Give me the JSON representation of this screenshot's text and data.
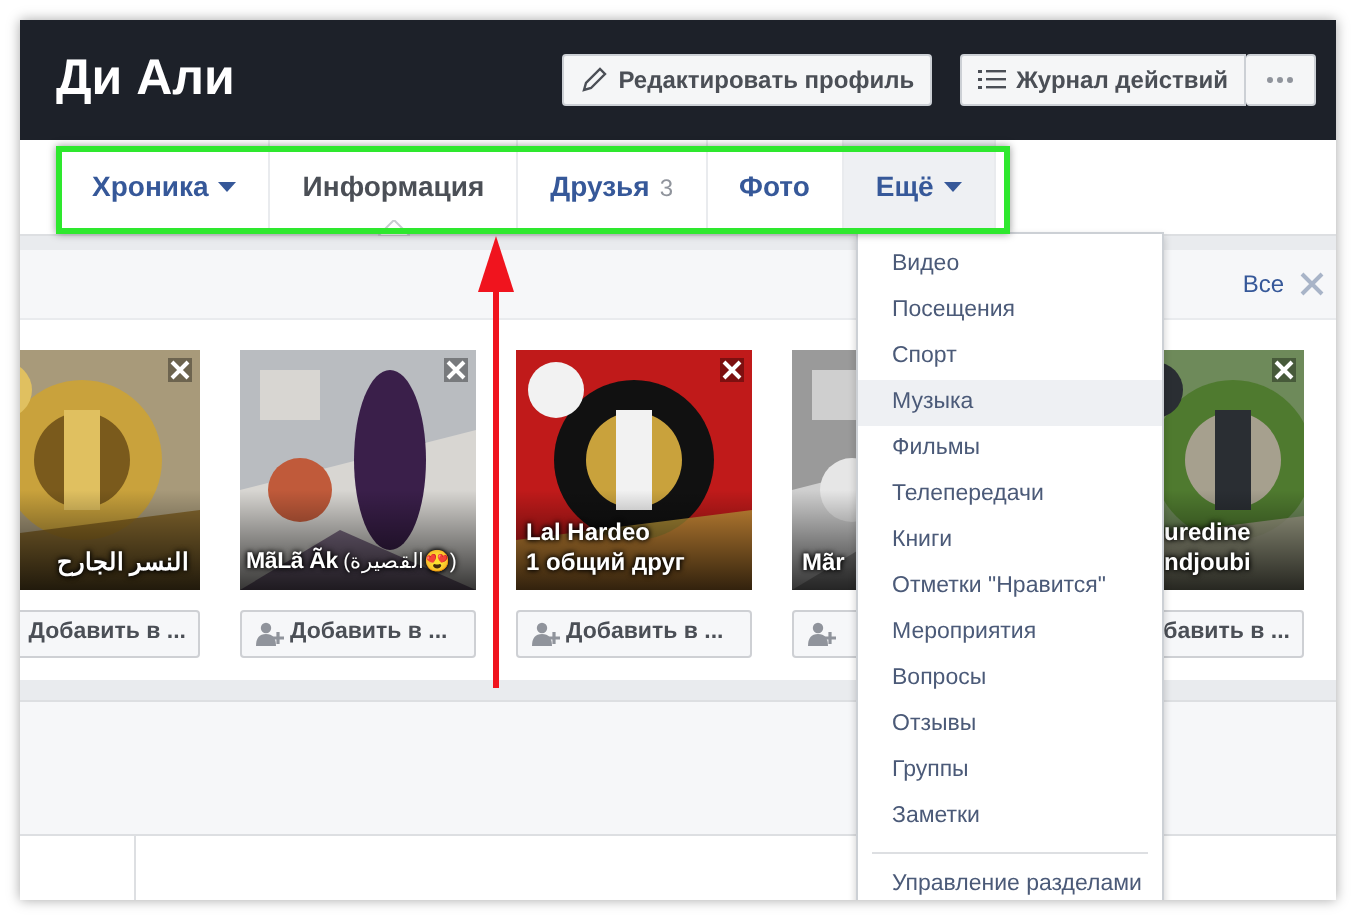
{
  "profile": {
    "name": "Ди Али",
    "buttons": [
      {
        "kind": "edit",
        "label": "Редактировать профиль"
      },
      {
        "kind": "log",
        "label": "Журнал действий"
      },
      {
        "kind": "more"
      }
    ]
  },
  "tabs": [
    {
      "label": "Хроника",
      "dropdown": true,
      "selected": false,
      "open": false
    },
    {
      "label": "Информация",
      "dropdown": false,
      "selected": true,
      "open": false
    },
    {
      "label": "Друзья",
      "count": "3",
      "dropdown": false,
      "selected": false,
      "open": false
    },
    {
      "label": "Фото",
      "dropdown": false,
      "selected": false,
      "open": false
    },
    {
      "label": "Ещё",
      "dropdown": true,
      "selected": false,
      "open": true
    }
  ],
  "suggestions": {
    "see_all": "Все",
    "cards": [
      {
        "name": "النسر الجارح",
        "button": "Добавить в ...",
        "add_icon": false,
        "closable": true
      },
      {
        "name": "**MãLã Ãk** (القصيرة😍)",
        "button": "Добавить в ...",
        "add_icon": true,
        "closable": true
      },
      {
        "name": "Lal Hardeo",
        "subtitle": "1 общий друг",
        "button": "Добавить в ...",
        "add_icon": true,
        "closable": true
      },
      {
        "name": "Mãr",
        "add_icon": true,
        "closable": false
      },
      {
        "name": "uredine",
        "subtitle": "ndjoubi",
        "button": "бавить в ...",
        "add_icon": false,
        "closable": true
      }
    ]
  },
  "more_menu": {
    "items": [
      {
        "label": "Видео",
        "selected": false
      },
      {
        "label": "Посещения",
        "selected": false
      },
      {
        "label": "Спорт",
        "selected": false
      },
      {
        "label": "Музыка",
        "selected": true
      },
      {
        "label": "Фильмы",
        "selected": false
      },
      {
        "label": "Телепередачи",
        "selected": false
      },
      {
        "label": "Книги",
        "selected": false
      },
      {
        "label": "Отметки \"Нравится\"",
        "selected": false
      },
      {
        "label": "Мероприятия",
        "selected": false
      },
      {
        "label": "Вопросы",
        "selected": false
      },
      {
        "label": "Отзывы",
        "selected": false
      },
      {
        "label": "Группы",
        "selected": false
      },
      {
        "label": "Заметки",
        "selected": false
      }
    ],
    "footer": "Управление разделами"
  }
}
